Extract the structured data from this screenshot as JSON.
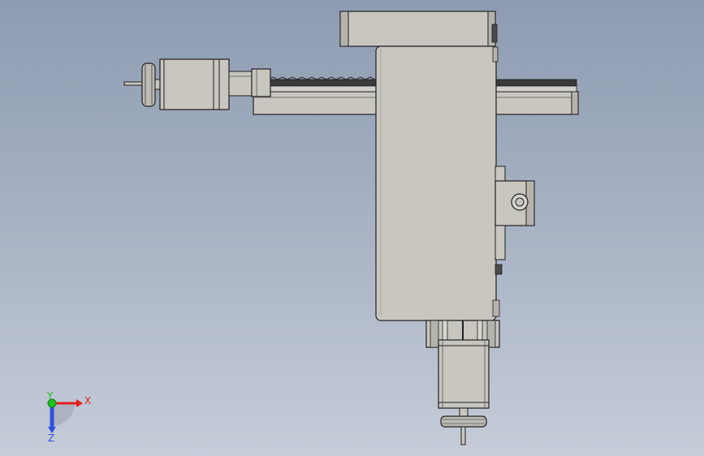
{
  "viewport": {
    "background_top": "#8e9bb1",
    "background_bottom": "#c6ccd8",
    "part_color": "#c8c6bf",
    "edge_color": "#202020",
    "rack_color": "#3a3a3a"
  },
  "triad": {
    "x_label": "X",
    "y_label": "Y",
    "z_label": "Z",
    "x_color": "#e02020",
    "y_color": "#20c020",
    "z_color": "#3050e0"
  }
}
